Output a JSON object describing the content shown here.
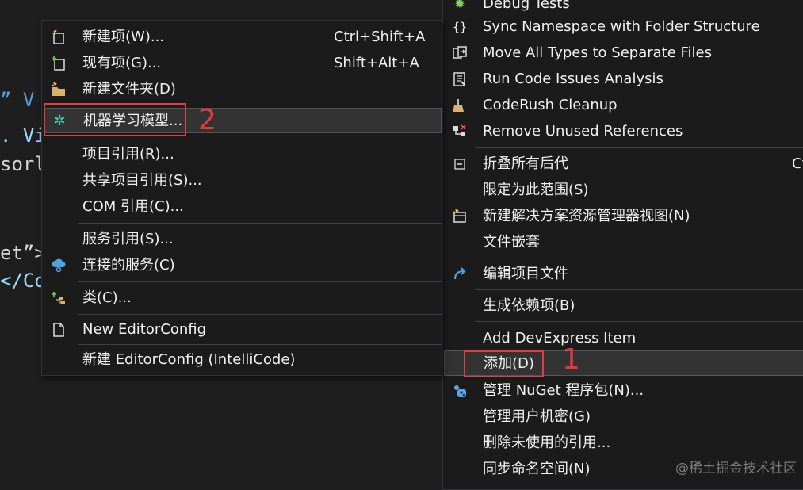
{
  "editor": {
    "lines": [
      "” V",
      ". Vi",
      "sorl",
      "et”>",
      "</Co"
    ]
  },
  "main_menu": {
    "items": [
      {
        "label": "Debug Tests",
        "icon": "bug-icon"
      },
      {
        "label": "Sync Namespace with Folder Structure",
        "icon": "namespace-sync-icon"
      },
      {
        "label": "Move All Types to Separate Files",
        "icon": "move-types-icon"
      },
      {
        "label": "Run Code Issues Analysis",
        "icon": "code-issues-icon"
      },
      {
        "label": "CodeRush Cleanup",
        "icon": "broom-icon"
      },
      {
        "label": "Remove Unused References",
        "icon": "remove-references-icon"
      },
      {
        "label": "折叠所有后代",
        "icon": "collapse-icon",
        "shortcut": "Ct"
      },
      {
        "label": "限定为此范围(S)"
      },
      {
        "label": "新建解决方案资源管理器视图(N)",
        "icon": "new-view-icon"
      },
      {
        "label": "文件嵌套"
      },
      {
        "label": "编辑项目文件",
        "icon": "edit-project-icon"
      },
      {
        "label": "生成依赖项(B)"
      },
      {
        "label": "Add DevExpress Item"
      },
      {
        "label": "添加(D)"
      },
      {
        "label": "管理 NuGet 程序包(N)...",
        "icon": "nuget-icon"
      },
      {
        "label": "管理用户机密(G)"
      },
      {
        "label": "删除未使用的引用..."
      },
      {
        "label": "同步命名空间(N)"
      }
    ]
  },
  "sub_menu": {
    "items": [
      {
        "label": "新建项(W)...",
        "shortcut": "Ctrl+Shift+A",
        "icon": "new-item-icon"
      },
      {
        "label": "现有项(G)...",
        "shortcut": "Shift+Alt+A",
        "icon": "existing-item-icon"
      },
      {
        "label": "新建文件夹(D)",
        "icon": "new-folder-icon"
      },
      {
        "label": "机器学习模型...",
        "icon": "ml-model-icon"
      },
      {
        "label": "项目引用(R)..."
      },
      {
        "label": "共享项目引用(S)..."
      },
      {
        "label": "COM 引用(C)..."
      },
      {
        "label": "服务引用(S)..."
      },
      {
        "label": "连接的服务(C)",
        "icon": "connected-service-icon"
      },
      {
        "label": "类(C)...",
        "icon": "class-icon"
      },
      {
        "label": "New EditorConfig",
        "icon": "file-icon"
      },
      {
        "label": "新建 EditorConfig (IntelliCode)"
      }
    ]
  },
  "annotations": {
    "step1": "1",
    "step2": "2"
  },
  "watermark": "@稀土掘金技术社区",
  "colors": {
    "menu_bg": "#1b1b1c",
    "highlight": "#333334",
    "annotation_red": "#e04040"
  }
}
